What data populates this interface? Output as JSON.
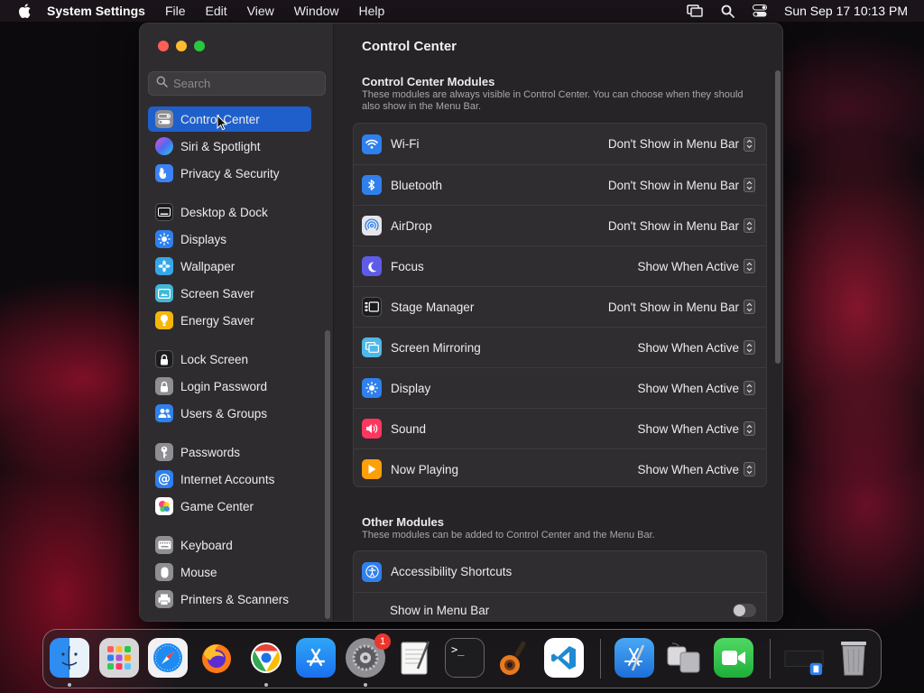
{
  "menubar": {
    "app_name": "System Settings",
    "menus": [
      "File",
      "Edit",
      "View",
      "Window",
      "Help"
    ],
    "clock": "Sun Sep 17  10:13 PM"
  },
  "sidebar": {
    "search_placeholder": "Search",
    "items": [
      {
        "label": "Control Center",
        "icon": "control-center-icon",
        "color": "#8e8e93",
        "selected": true
      },
      {
        "label": "Siri & Spotlight",
        "icon": "siri-icon",
        "color": "#b44cf0"
      },
      {
        "label": "Privacy & Security",
        "icon": "hand-icon",
        "color": "#3b82f6"
      },
      {
        "label": "Desktop & Dock",
        "icon": "dock-icon",
        "color": "#1c1c1e"
      },
      {
        "label": "Displays",
        "icon": "sun-icon",
        "color": "#2f80ed"
      },
      {
        "label": "Wallpaper",
        "icon": "flower-icon",
        "color": "#35a7e8"
      },
      {
        "label": "Screen Saver",
        "icon": "screen-saver-icon",
        "color": "#3fb8d8"
      },
      {
        "label": "Energy Saver",
        "icon": "bulb-icon",
        "color": "#f5b60a"
      },
      {
        "label": "Lock Screen",
        "icon": "lock-icon",
        "color": "#1c1c1e"
      },
      {
        "label": "Login Password",
        "icon": "padlock-icon",
        "color": "#8e8e93"
      },
      {
        "label": "Users & Groups",
        "icon": "users-icon",
        "color": "#2f80ed"
      },
      {
        "label": "Passwords",
        "icon": "key-icon",
        "color": "#8e8e93"
      },
      {
        "label": "Internet Accounts",
        "icon": "at-icon",
        "color": "#2f80ed"
      },
      {
        "label": "Game Center",
        "icon": "game-center-icon",
        "color": "#ffffff"
      },
      {
        "label": "Keyboard",
        "icon": "keyboard-icon",
        "color": "#8e8e93"
      },
      {
        "label": "Mouse",
        "icon": "mouse-icon",
        "color": "#8e8e93"
      },
      {
        "label": "Printers & Scanners",
        "icon": "printer-icon",
        "color": "#8e8e93"
      }
    ]
  },
  "content": {
    "title": "Control Center",
    "modules_title": "Control Center Modules",
    "modules_desc": "These modules are always visible in Control Center. You can choose when they should also show in the Menu Bar.",
    "modules": [
      {
        "label": "Wi-Fi",
        "value": "Don't Show in Menu Bar",
        "icon": "wifi-icon",
        "color": "#2f80ed"
      },
      {
        "label": "Bluetooth",
        "value": "Don't Show in Menu Bar",
        "icon": "bluetooth-icon",
        "color": "#2f80ed"
      },
      {
        "label": "AirDrop",
        "value": "Don't Show in Menu Bar",
        "icon": "airdrop-icon",
        "color": "#e6e6ea"
      },
      {
        "label": "Focus",
        "value": "Show When Active",
        "icon": "moon-icon",
        "color": "#5e5ce6"
      },
      {
        "label": "Stage Manager",
        "value": "Don't Show in Menu Bar",
        "icon": "stage-manager-icon",
        "color": "#1c1c1e"
      },
      {
        "label": "Screen Mirroring",
        "value": "Show When Active",
        "icon": "screen-mirroring-icon",
        "color": "#4fb8e8"
      },
      {
        "label": "Display",
        "value": "Show When Active",
        "icon": "display-sun-icon",
        "color": "#2f80ed"
      },
      {
        "label": "Sound",
        "value": "Show When Active",
        "icon": "speaker-icon",
        "color": "#ff375f"
      },
      {
        "label": "Now Playing",
        "value": "Show When Active",
        "icon": "play-icon",
        "color": "#ff9f0a"
      }
    ],
    "other_title": "Other Modules",
    "other_desc": "These modules can be added to Control Center and the Menu Bar.",
    "accessibility_label": "Accessibility Shortcuts",
    "show_in_menu_bar_label": "Show in Menu Bar",
    "show_in_menu_bar_on": false
  },
  "dock": {
    "apps": [
      "finder-icon",
      "launchpad-icon",
      "safari-icon",
      "firefox-icon",
      "chrome-icon",
      "app-store-icon",
      "system-settings-icon",
      "textedit-icon",
      "terminal-icon",
      "garageband-icon",
      "vscode-icon",
      "xcode-icon",
      "migration-assistant-icon",
      "facetime-icon",
      "downloads-stack-icon",
      "trash-icon"
    ],
    "settings_badge": "1"
  }
}
